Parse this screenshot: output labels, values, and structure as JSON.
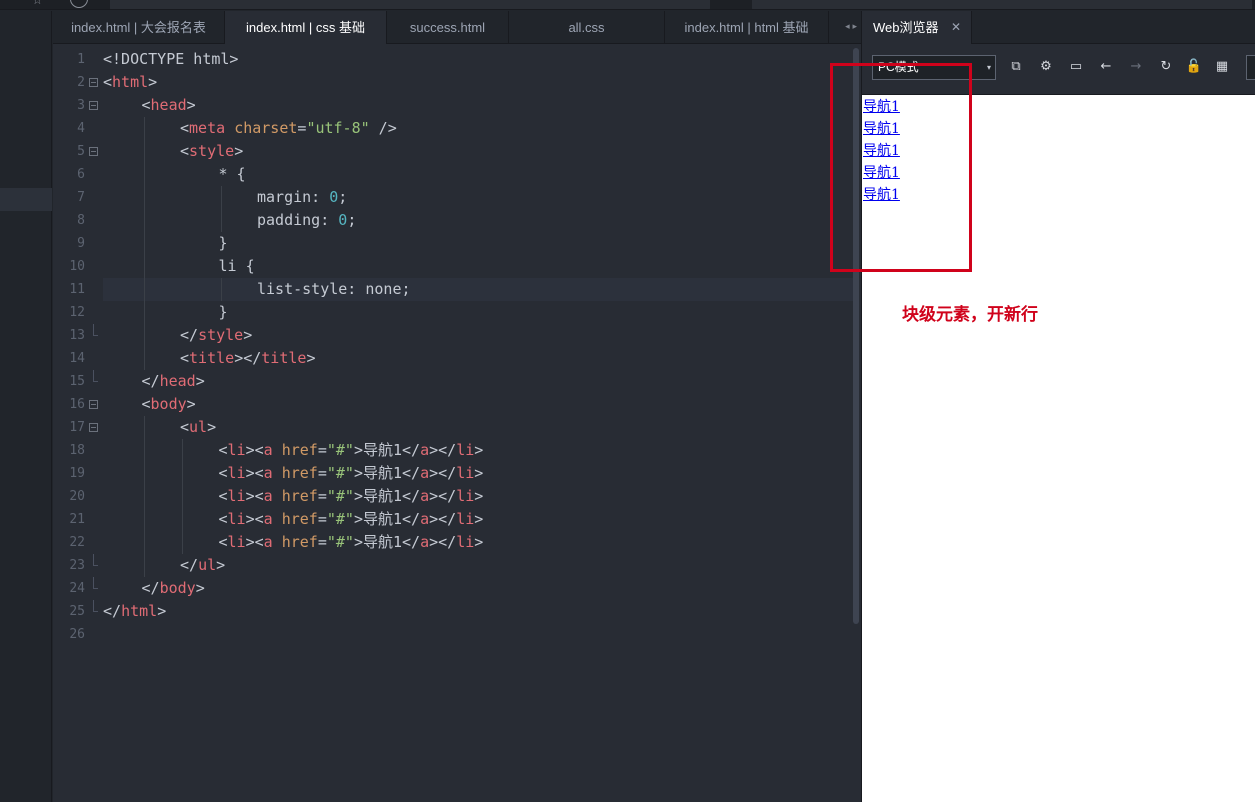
{
  "editor_tabs": [
    {
      "label": "index.html | 大会报名表",
      "active": false
    },
    {
      "label": "index.html | css 基础",
      "active": true
    },
    {
      "label": "success.html",
      "active": false
    },
    {
      "label": "all.css",
      "active": false
    },
    {
      "label": "index.html | html 基础",
      "active": false
    }
  ],
  "tab_scroll_arrows": "◂ ▸",
  "code_lines": [
    {
      "n": "1",
      "indent": 0,
      "fold": "",
      "html": "<span class=\"t-txt\">&lt;!DOCTYPE html&gt;</span>"
    },
    {
      "n": "2",
      "indent": 0,
      "fold": "open",
      "html": "<span class=\"t-txt\">&lt;</span><span class=\"t-tag\">html</span><span class=\"t-txt\">&gt;</span>"
    },
    {
      "n": "3",
      "indent": 1,
      "fold": "open",
      "html": "<span class=\"t-txt\">&lt;</span><span class=\"t-tag\">head</span><span class=\"t-txt\">&gt;</span>"
    },
    {
      "n": "4",
      "indent": 2,
      "fold": "",
      "html": "<span class=\"t-txt\">&lt;</span><span class=\"t-tag\">meta</span> <span class=\"t-attr\">charset</span><span class=\"t-txt\">=</span><span class=\"t-str\">\"utf-8\"</span><span class=\"t-txt\"> /&gt;</span>"
    },
    {
      "n": "5",
      "indent": 2,
      "fold": "open",
      "html": "<span class=\"t-txt\">&lt;</span><span class=\"t-tag\">style</span><span class=\"t-txt\">&gt;</span>"
    },
    {
      "n": "6",
      "indent": 3,
      "fold": "",
      "html": "<span class=\"t-txt\">* {</span>"
    },
    {
      "n": "7",
      "indent": 4,
      "fold": "",
      "html": "<span class=\"t-txt\">margin: </span><span class=\"t-num\">0</span><span class=\"t-txt\">;</span>"
    },
    {
      "n": "8",
      "indent": 4,
      "fold": "",
      "html": "<span class=\"t-txt\">padding: </span><span class=\"t-num\">0</span><span class=\"t-txt\">;</span>"
    },
    {
      "n": "9",
      "indent": 3,
      "fold": "",
      "html": "<span class=\"t-txt\">}</span>"
    },
    {
      "n": "10",
      "indent": 3,
      "fold": "",
      "html": "<span class=\"t-txt\">li {</span>"
    },
    {
      "n": "11",
      "indent": 4,
      "fold": "",
      "html": "<span class=\"t-txt\">list-style: none;</span>"
    },
    {
      "n": "12",
      "indent": 3,
      "fold": "",
      "html": "<span class=\"t-txt\">}</span>"
    },
    {
      "n": "13",
      "indent": 2,
      "fold": "end",
      "html": "<span class=\"t-txt\">&lt;/</span><span class=\"t-tag\">style</span><span class=\"t-txt\">&gt;</span>"
    },
    {
      "n": "14",
      "indent": 2,
      "fold": "",
      "html": "<span class=\"t-txt\">&lt;</span><span class=\"t-tag\">title</span><span class=\"t-txt\">&gt;&lt;/</span><span class=\"t-tag\">title</span><span class=\"t-txt\">&gt;</span>"
    },
    {
      "n": "15",
      "indent": 1,
      "fold": "end",
      "html": "<span class=\"t-txt\">&lt;/</span><span class=\"t-tag\">head</span><span class=\"t-txt\">&gt;</span>"
    },
    {
      "n": "16",
      "indent": 1,
      "fold": "open",
      "html": "<span class=\"t-txt\">&lt;</span><span class=\"t-tag\">body</span><span class=\"t-txt\">&gt;</span>"
    },
    {
      "n": "17",
      "indent": 2,
      "fold": "open",
      "html": "<span class=\"t-txt\">&lt;</span><span class=\"t-tag\">ul</span><span class=\"t-txt\">&gt;</span>"
    },
    {
      "n": "18",
      "indent": 3,
      "fold": "",
      "html": "<span class=\"t-txt\">&lt;</span><span class=\"t-tag\">li</span><span class=\"t-txt\">&gt;&lt;</span><span class=\"t-tag\">a</span> <span class=\"t-attr\">href</span><span class=\"t-txt\">=</span><span class=\"t-str\">\"#\"</span><span class=\"t-txt\">&gt;导航1&lt;/</span><span class=\"t-tag\">a</span><span class=\"t-txt\">&gt;&lt;/</span><span class=\"t-tag\">li</span><span class=\"t-txt\">&gt;</span>"
    },
    {
      "n": "19",
      "indent": 3,
      "fold": "",
      "html": "<span class=\"t-txt\">&lt;</span><span class=\"t-tag\">li</span><span class=\"t-txt\">&gt;&lt;</span><span class=\"t-tag\">a</span> <span class=\"t-attr\">href</span><span class=\"t-txt\">=</span><span class=\"t-str\">\"#\"</span><span class=\"t-txt\">&gt;导航1&lt;/</span><span class=\"t-tag\">a</span><span class=\"t-txt\">&gt;&lt;/</span><span class=\"t-tag\">li</span><span class=\"t-txt\">&gt;</span>"
    },
    {
      "n": "20",
      "indent": 3,
      "fold": "",
      "html": "<span class=\"t-txt\">&lt;</span><span class=\"t-tag\">li</span><span class=\"t-txt\">&gt;&lt;</span><span class=\"t-tag\">a</span> <span class=\"t-attr\">href</span><span class=\"t-txt\">=</span><span class=\"t-str\">\"#\"</span><span class=\"t-txt\">&gt;导航1&lt;/</span><span class=\"t-tag\">a</span><span class=\"t-txt\">&gt;&lt;/</span><span class=\"t-tag\">li</span><span class=\"t-txt\">&gt;</span>"
    },
    {
      "n": "21",
      "indent": 3,
      "fold": "",
      "html": "<span class=\"t-txt\">&lt;</span><span class=\"t-tag\">li</span><span class=\"t-txt\">&gt;&lt;</span><span class=\"t-tag\">a</span> <span class=\"t-attr\">href</span><span class=\"t-txt\">=</span><span class=\"t-str\">\"#\"</span><span class=\"t-txt\">&gt;导航1&lt;/</span><span class=\"t-tag\">a</span><span class=\"t-txt\">&gt;&lt;/</span><span class=\"t-tag\">li</span><span class=\"t-txt\">&gt;</span>"
    },
    {
      "n": "22",
      "indent": 3,
      "fold": "",
      "html": "<span class=\"t-txt\">&lt;</span><span class=\"t-tag\">li</span><span class=\"t-txt\">&gt;&lt;</span><span class=\"t-tag\">a</span> <span class=\"t-attr\">href</span><span class=\"t-txt\">=</span><span class=\"t-str\">\"#\"</span><span class=\"t-txt\">&gt;导航1&lt;/</span><span class=\"t-tag\">a</span><span class=\"t-txt\">&gt;&lt;/</span><span class=\"t-tag\">li</span><span class=\"t-txt\">&gt;</span>"
    },
    {
      "n": "23",
      "indent": 2,
      "fold": "end",
      "html": "<span class=\"t-txt\">&lt;/</span><span class=\"t-tag\">ul</span><span class=\"t-txt\">&gt;</span>"
    },
    {
      "n": "24",
      "indent": 1,
      "fold": "end",
      "html": "<span class=\"t-txt\">&lt;/</span><span class=\"t-tag\">body</span><span class=\"t-txt\">&gt;</span>"
    },
    {
      "n": "25",
      "indent": 0,
      "fold": "end",
      "html": "<span class=\"t-txt\">&lt;/</span><span class=\"t-tag\">html</span><span class=\"t-txt\">&gt;</span>"
    },
    {
      "n": "26",
      "indent": 0,
      "fold": "",
      "html": ""
    }
  ],
  "current_line": "11",
  "browser": {
    "tab_title": "Web浏览器",
    "close_glyph": "✕",
    "mode_select_value": "PC模式",
    "select_arrow": "▾",
    "icons": [
      {
        "name": "open-external-icon",
        "glyph": "⧉",
        "enabled": true
      },
      {
        "name": "settings-icon",
        "glyph": "⚙",
        "enabled": true
      },
      {
        "name": "console-icon",
        "glyph": "▭",
        "enabled": true
      },
      {
        "name": "back-icon",
        "glyph": "←",
        "enabled": true
      },
      {
        "name": "forward-icon",
        "glyph": "→",
        "enabled": false
      },
      {
        "name": "refresh-icon",
        "glyph": "↻",
        "enabled": true
      },
      {
        "name": "lock-icon",
        "glyph": "🔓",
        "enabled": true
      },
      {
        "name": "qrcode-icon",
        "glyph": "▦",
        "enabled": true
      }
    ],
    "nav_links": [
      "导航1",
      "导航1",
      "导航1",
      "导航1",
      "导航1"
    ]
  },
  "annotation": {
    "text": "块级元素，开新行",
    "color": "#d0021b"
  }
}
